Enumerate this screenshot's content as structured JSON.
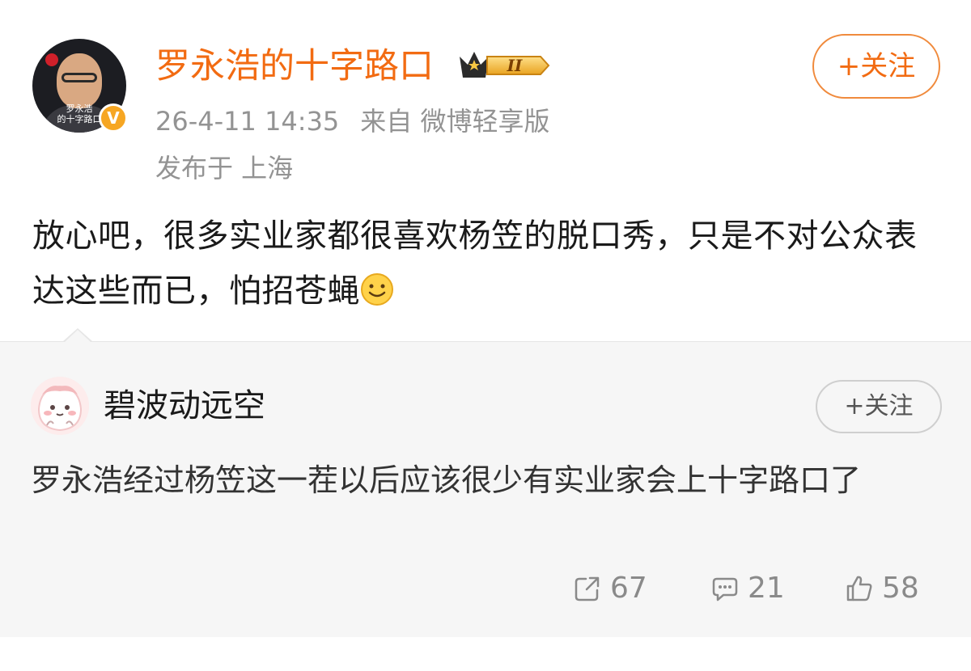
{
  "post": {
    "author_name": "罗永浩的十字路口",
    "avatar_caption": "罗永浩\n的十字路口",
    "verified_mark": "V",
    "level_badge": "II",
    "timestamp": "26-4-11 14:35",
    "source": "来自 微博轻享版",
    "location": "发布于 上海",
    "follow_label": "+关注",
    "text": "放心吧，很多实业家都很喜欢杨笠的脱口秀，只是不对公众表达这些而已，怕招苍蝇",
    "emoji": "smile-emoji"
  },
  "retweet": {
    "author_name": "碧波动远空",
    "follow_label": "+关注",
    "text": "罗永浩经过杨笠这一茬以后应该很少有实业家会上十字路口了"
  },
  "actions": {
    "reposts": "67",
    "comments": "21",
    "likes": "58"
  },
  "colors": {
    "accent": "#f26b12",
    "muted_text": "#939393",
    "retweet_bg": "#f6f6f6",
    "verified": "#f6a623"
  }
}
